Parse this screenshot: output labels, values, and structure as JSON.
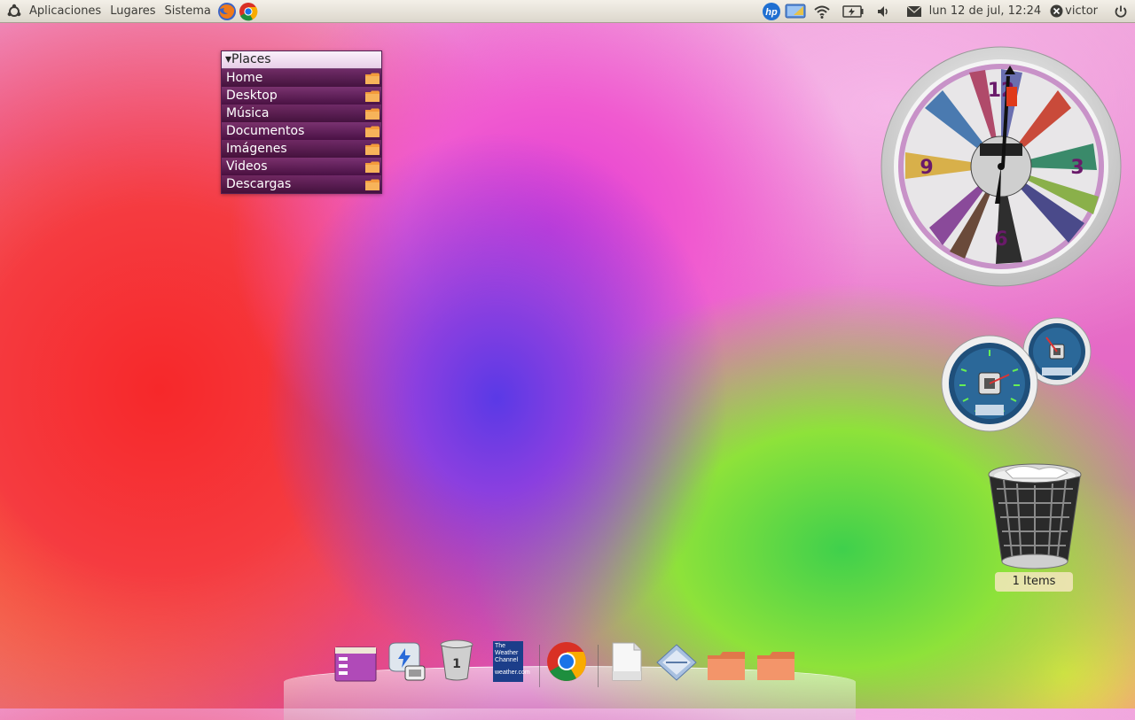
{
  "panel": {
    "menus": [
      "Aplicaciones",
      "Lugares",
      "Sistema"
    ],
    "clock": "lun 12 de jul, 12:24",
    "user": "victor"
  },
  "places": {
    "title": "Places",
    "items": [
      "Home",
      "Desktop",
      "Música",
      "Documentos",
      "Imágenes",
      "Videos",
      "Descargas"
    ]
  },
  "clock_widget": {
    "numerals": [
      "12",
      "3",
      "6",
      "9"
    ]
  },
  "trash": {
    "label": "1 Items"
  },
  "dock": {
    "weather_text": [
      "The",
      "Weather",
      "Channel",
      "weather.com"
    ],
    "items": [
      "files-window-icon",
      "power-manager-icon",
      "trash-icon",
      "weather-channel-icon",
      "chrome-icon",
      "document-icon",
      "mail-icon",
      "folder-icon",
      "folder-icon"
    ]
  },
  "colors": {
    "panel_bg": "#dcd7cc",
    "places_header": "#f5e6f5",
    "folder": "#f39a3b",
    "chrome_red": "#d93025",
    "chrome_green": "#1e8e3e",
    "chrome_yellow": "#f9ab00",
    "chrome_blue": "#1a73e8"
  }
}
